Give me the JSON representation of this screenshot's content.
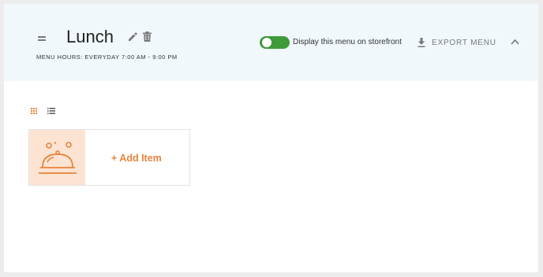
{
  "menu": {
    "title": "Lunch",
    "hours": "MENU HOURS: EVERYDAY 7:00 AM - 9:00 PM",
    "storefront_toggle": {
      "label": "Display this menu on storefront",
      "on": true
    },
    "export_label": "EXPORT MENU"
  },
  "items": {
    "add_label": "+ Add Item"
  },
  "colors": {
    "accent": "#e8833a",
    "toggle_on": "#3f9a3a",
    "header_bg": "#f0f8fc",
    "thumb_bg": "#fde3d2"
  },
  "icons": [
    "drag-handle-icon",
    "pencil-icon",
    "trash-icon",
    "download-icon",
    "chevron-up-icon",
    "grid-view-icon",
    "list-view-icon",
    "cloche-icon"
  ]
}
